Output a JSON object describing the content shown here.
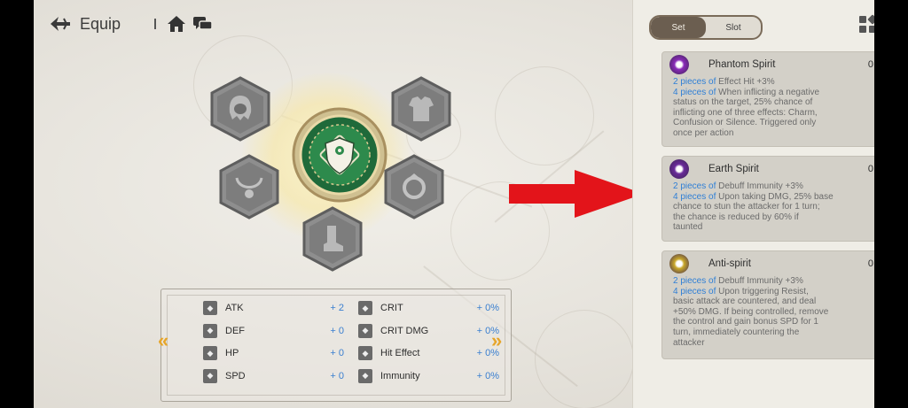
{
  "header": {
    "title": "Equip"
  },
  "icons": {
    "back": "back-arrow-icon",
    "home": "home-icon",
    "chat": "chat-icon",
    "grid": "grid-icon"
  },
  "equipment": {
    "slots": [
      {
        "name": "helmet",
        "icon": "helmet-icon"
      },
      {
        "name": "armor",
        "icon": "armor-icon"
      },
      {
        "name": "necklace",
        "icon": "necklace-icon"
      },
      {
        "name": "ring",
        "icon": "ring-icon"
      },
      {
        "name": "boots",
        "icon": "boots-icon"
      }
    ],
    "center": {
      "icon": "shield-emblem-icon"
    }
  },
  "stats": {
    "left": [
      {
        "label": "ATK",
        "value": "+ 2",
        "icon": "sword-icon"
      },
      {
        "label": "DEF",
        "value": "+ 0",
        "icon": "shield-icon"
      },
      {
        "label": "HP",
        "value": "+ 0",
        "icon": "heart-icon"
      },
      {
        "label": "SPD",
        "value": "+ 0",
        "icon": "speed-icon"
      }
    ],
    "right": [
      {
        "label": "CRIT",
        "value": "+ 0%",
        "icon": "crit-icon"
      },
      {
        "label": "CRIT DMG",
        "value": "+ 0%",
        "icon": "crit-dmg-icon"
      },
      {
        "label": "Hit Effect",
        "value": "+ 0%",
        "icon": "target-icon"
      },
      {
        "label": "Immunity",
        "value": "+ 0%",
        "icon": "moon-icon"
      }
    ],
    "prev_label": "«",
    "next_label": "»"
  },
  "toggle": {
    "options": [
      "Set",
      "Slot"
    ],
    "selected": "Set"
  },
  "sets": [
    {
      "name": "Phantom Spirit",
      "count": "0",
      "icon_color": "#8a2bb8",
      "two_label": "2 pieces of",
      "two_text": " Effect Hit +3%",
      "four_label": "4 pieces of",
      "four_text": " When inflicting a negative",
      "lines": [
        "status on the target, 25% chance of",
        "inflicting one of three effects: Charm,",
        "Confusion or Silence. Triggered only",
        "once per action"
      ]
    },
    {
      "name": "Earth Spirit",
      "count": "0",
      "icon_color": "#6a2a9a",
      "two_label": "2 pieces of",
      "two_text": " Debuff Immunity +3%",
      "four_label": "4 pieces of",
      "four_text": " Upon taking DMG, 25% base",
      "lines": [
        "chance to stun the attacker for 1 turn;",
        "the chance is reduced by 60% if",
        "taunted"
      ]
    },
    {
      "name": "Anti-spirit",
      "count": "0",
      "icon_color": "#c9a82a",
      "two_label": "2 pieces of",
      "two_text": " Debuff Immunity +3%",
      "four_label": "4 pieces of",
      "four_text": " Upon triggering Resist,",
      "lines": [
        "basic attack are countered, and deal",
        "+50% DMG. If being controlled, remove",
        "the control and gain bonus SPD for 1",
        "turn, immediately countering the",
        "attacker"
      ]
    }
  ],
  "colors": {
    "accent_blue": "#2f7fd6",
    "arrow_red": "#e3141a",
    "nav_gold": "#e6a52a"
  }
}
